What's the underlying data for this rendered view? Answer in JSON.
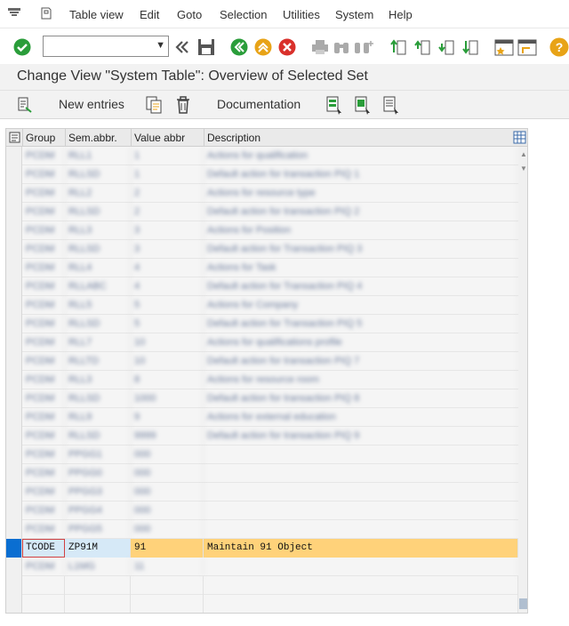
{
  "menubar": {
    "items": [
      "Table view",
      "Edit",
      "Goto",
      "Selection",
      "Utilities",
      "System",
      "Help"
    ]
  },
  "title": "Change View \"System Table\": Overview of Selected Set",
  "app_toolbar": {
    "new_entries": "New entries",
    "documentation": "Documentation"
  },
  "table": {
    "headers": [
      "Group",
      "Sem.abbr.",
      "Value abbr",
      "Description"
    ],
    "blurred_rows": [
      [
        "PCDM",
        "RLL1",
        "1",
        "Actions for qualification"
      ],
      [
        "PCDM",
        "RLLSD",
        "1",
        "Default action for transaction PIQ 1"
      ],
      [
        "PCDM",
        "RLL2",
        "2",
        "Actions for resource type"
      ],
      [
        "PCDM",
        "RLLSD",
        "2",
        "Default action for transaction PIQ 2"
      ],
      [
        "PCDM",
        "RLL3",
        "3",
        "Actions for Position"
      ],
      [
        "PCDM",
        "RLLSD",
        "3",
        "Default action for Transaction PIQ 3"
      ],
      [
        "PCDM",
        "RLL4",
        "4",
        "Actions for Task"
      ],
      [
        "PCDM",
        "RLLABC",
        "4",
        "Default action for Transaction PIQ 4"
      ],
      [
        "PCDM",
        "RLL5",
        "5",
        "Actions for Company"
      ],
      [
        "PCDM",
        "RLLSD",
        "5",
        "Default action for Transaction PIQ 5"
      ],
      [
        "PCDM",
        "RLL7",
        "10",
        "Actions for qualifications profile"
      ],
      [
        "PCDM",
        "RLLTD",
        "10",
        "Default action for transaction PIQ 7"
      ],
      [
        "PCDM",
        "RLL3",
        "8",
        "Actions for resource room"
      ],
      [
        "PCDM",
        "RLLSD",
        "1000",
        "Default action for transaction PIQ 8"
      ],
      [
        "PCDM",
        "RLL9",
        "9",
        "Actions for external education"
      ],
      [
        "PCDM",
        "RLLSD",
        "9999",
        "Default action for transaction PIQ 9"
      ],
      [
        "PCDM",
        "PPGG1",
        "000",
        ""
      ],
      [
        "PCDM",
        "PPGG0",
        "000",
        ""
      ],
      [
        "PCDM",
        "PPGG3",
        "000",
        ""
      ],
      [
        "PCDM",
        "PPGG4",
        "000",
        ""
      ],
      [
        "PCDM",
        "PPGG5",
        "000",
        ""
      ]
    ],
    "highlighted_row": {
      "group": "TCODE",
      "sem": "ZP91M",
      "value": "91",
      "desc": "Maintain 91 Object"
    },
    "after_row": [
      "PCDM",
      "L1MG",
      "11",
      ""
    ]
  }
}
